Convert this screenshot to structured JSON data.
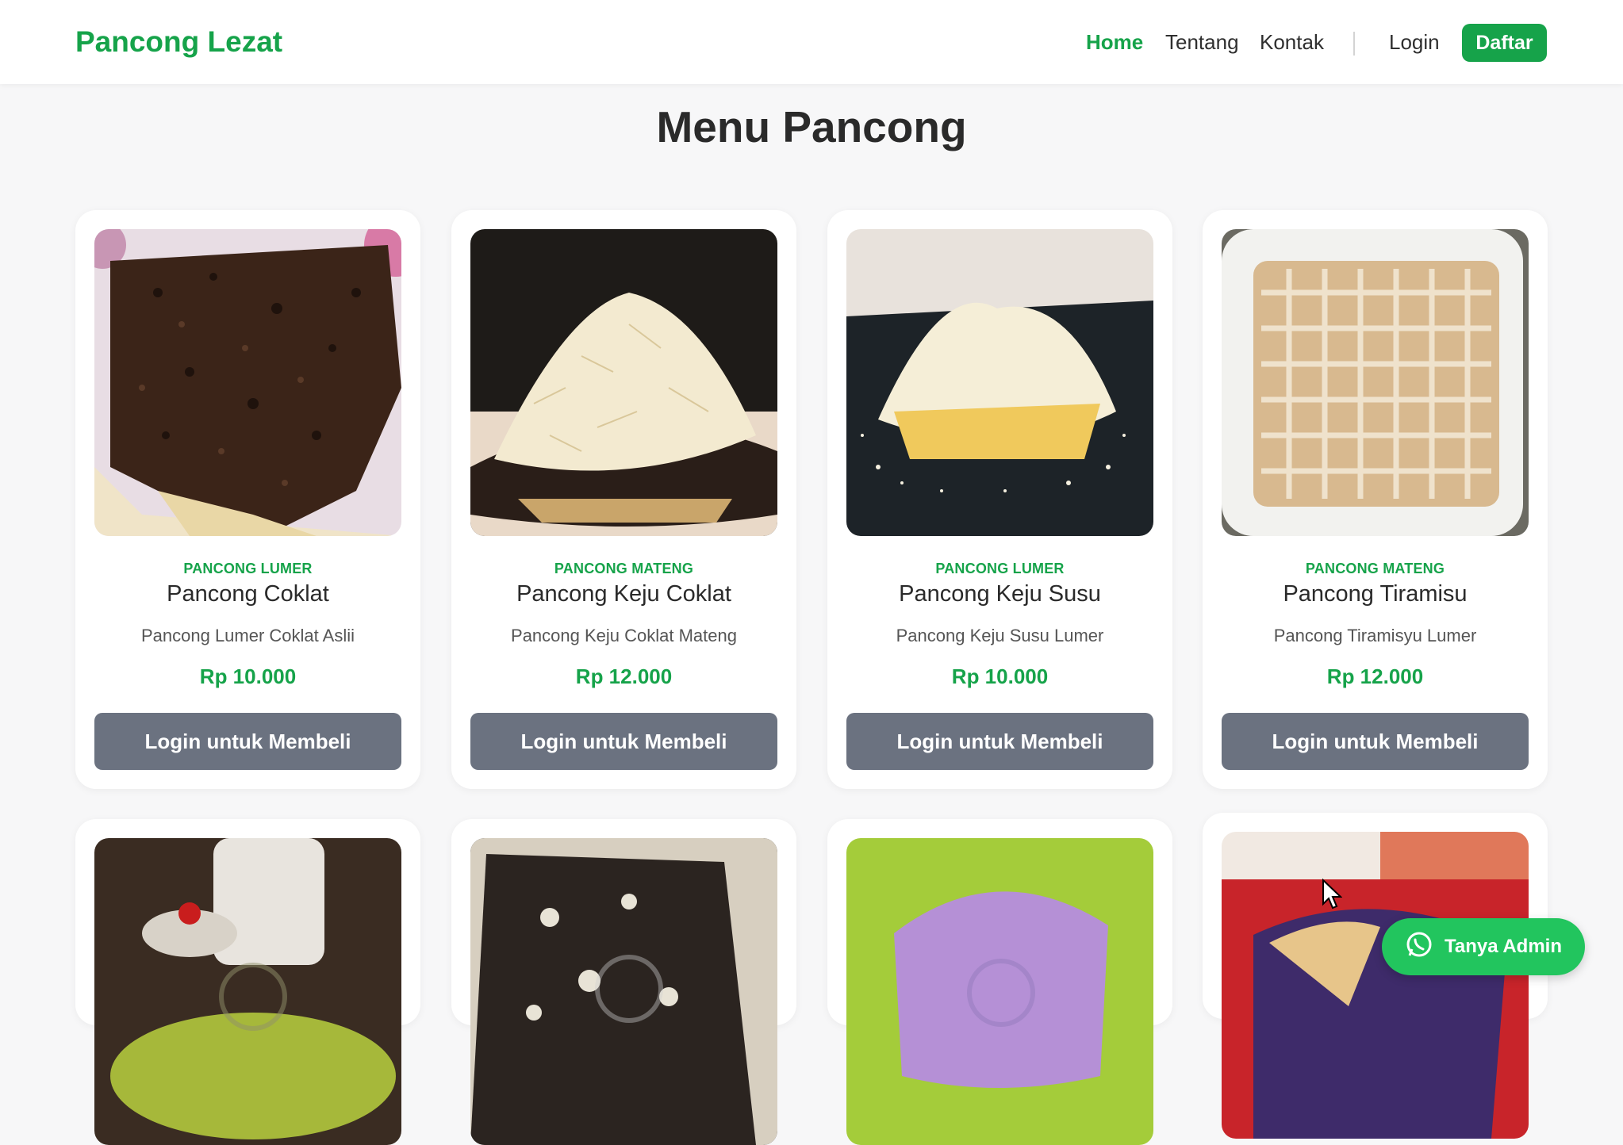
{
  "nav": {
    "brand": "Pancong Lezat",
    "links": [
      {
        "label": "Home",
        "active": true
      },
      {
        "label": "Tentang",
        "active": false
      },
      {
        "label": "Kontak",
        "active": false
      }
    ],
    "login": "Login",
    "daftar": "Daftar"
  },
  "page": {
    "title": "Menu Pancong"
  },
  "products": [
    {
      "category": "PANCONG LUMER",
      "name": "Pancong Coklat",
      "description": "Pancong Lumer Coklat Aslii",
      "price": "Rp 10.000",
      "button": "Login untuk Membeli"
    },
    {
      "category": "PANCONG MATENG",
      "name": "Pancong Keju Coklat",
      "description": "Pancong Keju Coklat Mateng",
      "price": "Rp 12.000",
      "button": "Login untuk Membeli"
    },
    {
      "category": "PANCONG LUMER",
      "name": "Pancong Keju Susu",
      "description": "Pancong Keju Susu Lumer",
      "price": "Rp 10.000",
      "button": "Login untuk Membeli"
    },
    {
      "category": "PANCONG MATENG",
      "name": "Pancong Tiramisu",
      "description": "Pancong Tiramisyu Lumer",
      "price": "Rp 12.000",
      "button": "Login untuk Membeli"
    }
  ],
  "whatsapp": {
    "label": "Tanya Admin"
  },
  "colors": {
    "accent": "#16a34a",
    "button_gray": "#6b7280",
    "whatsapp": "#22c55e"
  }
}
